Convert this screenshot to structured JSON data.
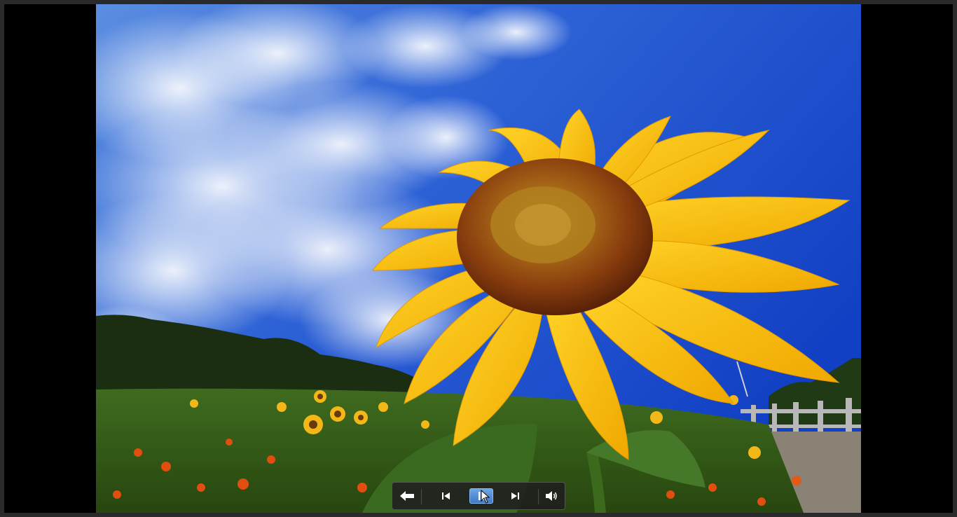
{
  "window": {
    "title": ""
  },
  "photo": {
    "subject": "sunflower-photo"
  },
  "controls": {
    "back_icon": "back-arrow-icon",
    "prev_icon": "skip-previous-icon",
    "play_pause_icon": "pause-icon",
    "next_icon": "skip-next-icon",
    "volume_icon": "volume-icon",
    "active": "play-pause"
  },
  "colors": {
    "bar_bg": "#1e1e1e",
    "active_button": "#4a86d4",
    "sky": "#1a4fd0",
    "petal": "#f7c31a"
  }
}
